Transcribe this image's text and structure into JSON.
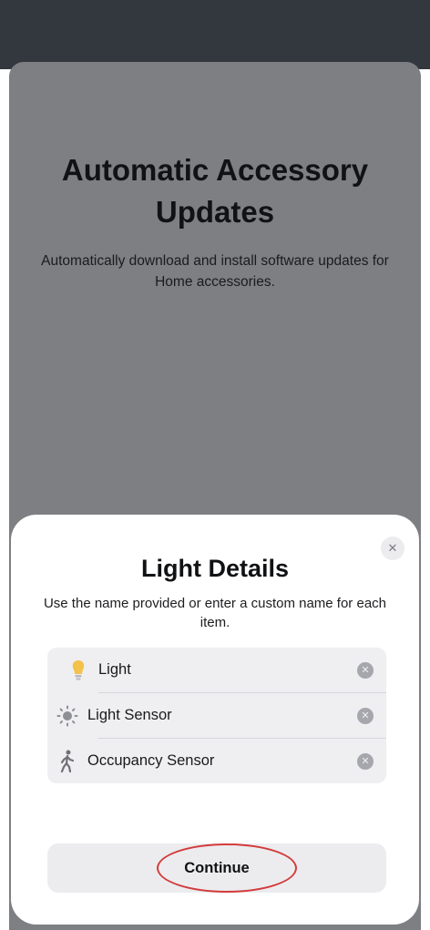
{
  "background_screen": {
    "title": "Automatic Accessory Updates",
    "subtitle": "Automatically download and install software updates for Home accessories."
  },
  "modal": {
    "title": "Light Details",
    "subtitle": "Use the name provided or enter a custom name for each item.",
    "close_icon": "close-icon",
    "items": [
      {
        "label": "Light",
        "icon": "lightbulb-icon"
      },
      {
        "label": "Light Sensor",
        "icon": "sun-icon"
      },
      {
        "label": "Occupancy Sensor",
        "icon": "walking-person-icon"
      }
    ],
    "clear_icon": "clear-icon",
    "continue_label": "Continue"
  },
  "colors": {
    "highlight": "#d33b3b",
    "accent_bulb": "#f3c24a"
  }
}
